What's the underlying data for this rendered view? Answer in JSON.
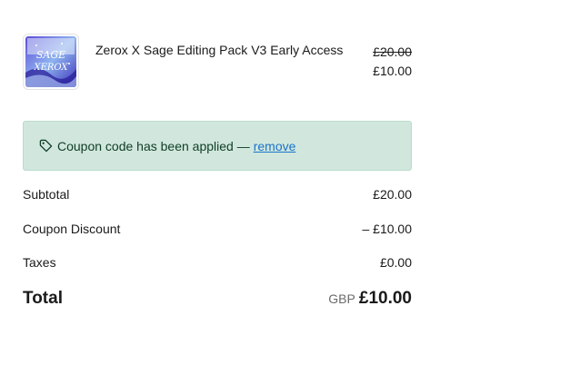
{
  "product": {
    "name": "Zerox X Sage Editing Pack V3 Early Access",
    "original_price": "£20.00",
    "price": "£10.00",
    "thumbnail_icon": "product-artwork",
    "thumbnail_text_top": "SAGE",
    "thumbnail_text_bottom": "XEROX"
  },
  "coupon": {
    "icon": "tag-icon",
    "message": "Coupon code has been applied —",
    "remove_label": "remove",
    "background": "#d1e7dd"
  },
  "summary": {
    "subtotal_label": "Subtotal",
    "subtotal_value": "£20.00",
    "discount_label": "Coupon Discount",
    "discount_value": "– £10.00",
    "taxes_label": "Taxes",
    "taxes_value": "£0.00",
    "total_label": "Total",
    "total_currency": "GBP",
    "total_value": "£10.00"
  }
}
